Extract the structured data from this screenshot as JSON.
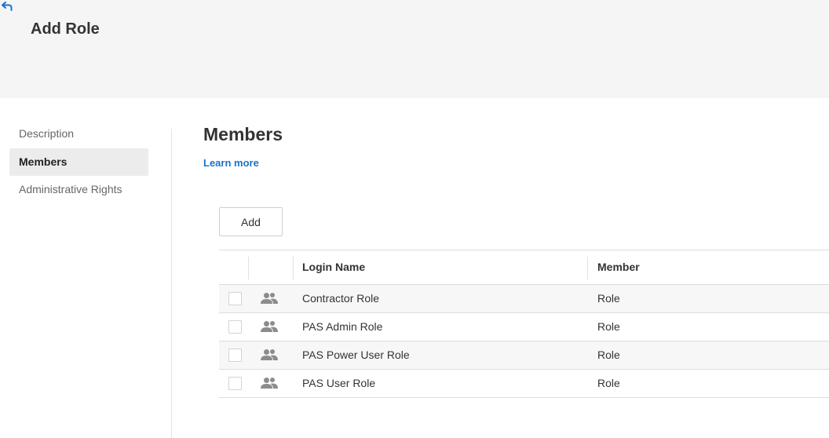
{
  "header": {
    "title": "Add Role",
    "back_icon": "back-arrow-icon"
  },
  "sidenav": {
    "items": [
      {
        "label": "Description",
        "active": false
      },
      {
        "label": "Members",
        "active": true
      },
      {
        "label": "Administrative Rights",
        "active": false
      }
    ]
  },
  "main": {
    "title": "Members",
    "learn_more": "Learn more",
    "add_label": "Add"
  },
  "grid": {
    "columns": {
      "login": "Login Name",
      "member": "Member"
    },
    "row_icon": "users-group-icon",
    "rows": [
      {
        "login": "Contractor Role",
        "member": "Role"
      },
      {
        "login": "PAS Admin Role",
        "member": "Role"
      },
      {
        "login": "PAS Power User Role",
        "member": "Role"
      },
      {
        "login": "PAS User Role",
        "member": "Role"
      }
    ]
  },
  "colors": {
    "accent": "#1a73c9",
    "header_bg": "#f5f5f5",
    "active_nav_bg": "#ececec",
    "icon_gray": "#8c8c8c"
  }
}
